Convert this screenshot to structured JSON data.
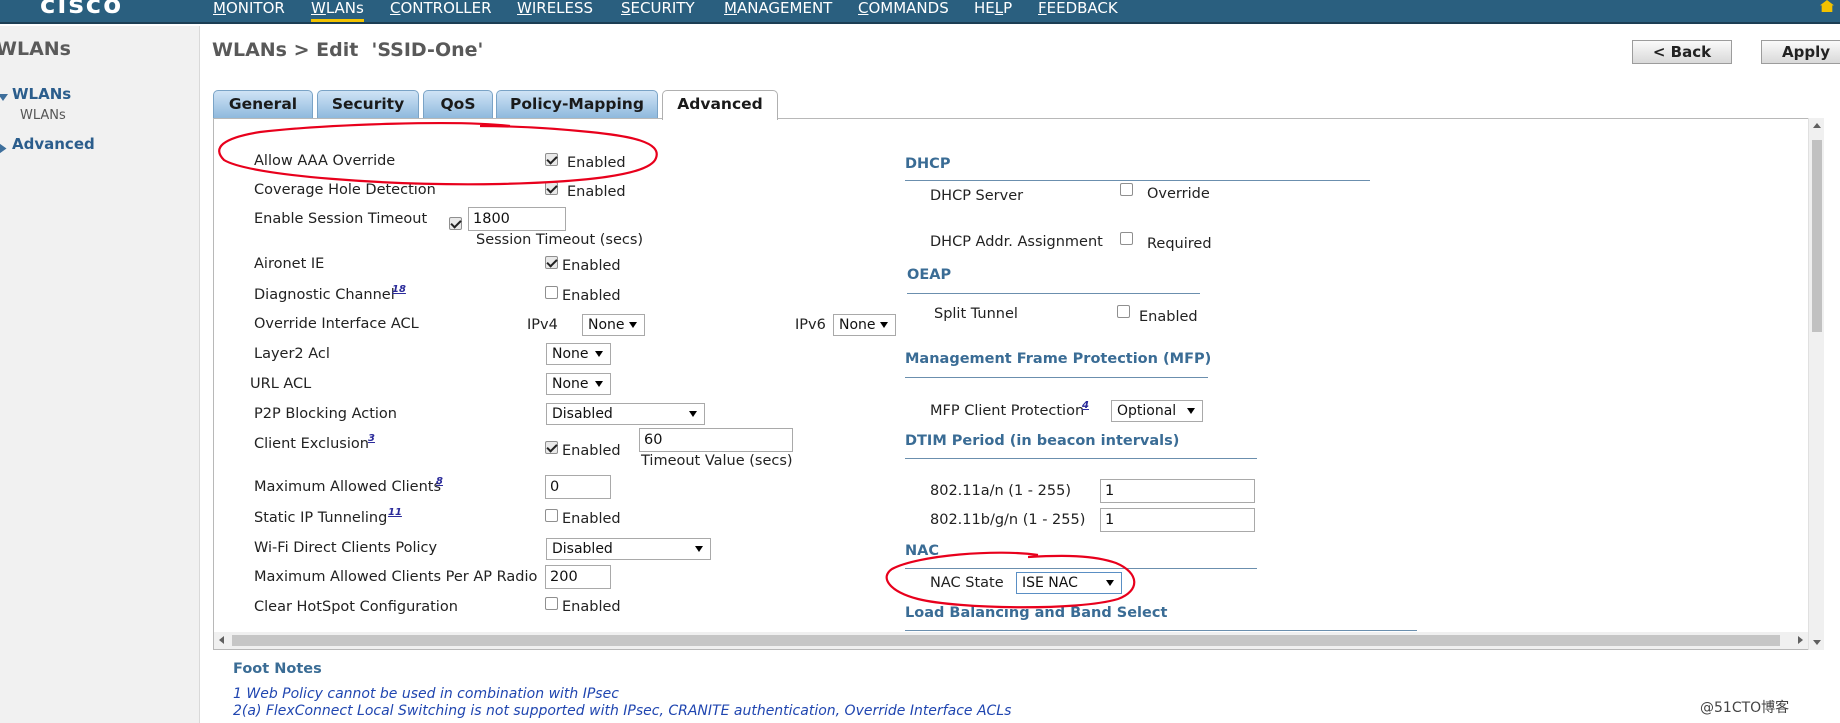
{
  "app": {
    "brand": "cisco"
  },
  "nav": {
    "items": [
      {
        "accel": "M",
        "rest": "ONITOR"
      },
      {
        "accel": "W",
        "rest": "LANs"
      },
      {
        "accel": "C",
        "rest": "ONTROLLER"
      },
      {
        "accel": "W",
        "rest": "IRELESS"
      },
      {
        "accel": "S",
        "rest": "ECURITY"
      },
      {
        "accel": "M",
        "rest": "ANAGEMENT"
      },
      {
        "accel": "C",
        "rest": "OMMANDS"
      },
      {
        "accel": "",
        "pre": "HE",
        "acc2": "L",
        "rest": "P"
      },
      {
        "accel": "F",
        "rest": "EEDBACK"
      }
    ],
    "active_index": 1
  },
  "sidebar": {
    "title": "WLANs",
    "groups": [
      {
        "label": "WLANs",
        "sub": "WLANs"
      },
      {
        "label": "Advanced"
      }
    ]
  },
  "header": {
    "title": "WLANs > Edit  'SSID-One'",
    "back_label": "< Back",
    "apply_label": "Apply"
  },
  "tabs": [
    "General",
    "Security",
    "QoS",
    "Policy-Mapping",
    "Advanced"
  ],
  "active_tab": "Advanced",
  "left": {
    "allow_aaa_override": {
      "label": "Allow AAA Override",
      "checked": true,
      "text": "Enabled"
    },
    "coverage_hole": {
      "label": "Coverage Hole Detection",
      "checked": true,
      "text": "Enabled"
    },
    "session_timeout": {
      "label": "Enable Session Timeout",
      "checked": true,
      "value": "1800",
      "sub": "Session Timeout (secs)"
    },
    "aironet_ie": {
      "label": "Aironet IE",
      "checked": true,
      "text": "Enabled"
    },
    "diagnostic_channel": {
      "label": "Diagnostic Channel",
      "footnote": "18",
      "checked": false,
      "text": "Enabled"
    },
    "override_acl": {
      "label": "Override Interface ACL",
      "ipv4_label": "IPv4",
      "ipv4_value": "None",
      "ipv6_label": "IPv6",
      "ipv6_value": "None"
    },
    "layer2_acl": {
      "label": "Layer2 Acl",
      "value": "None"
    },
    "url_acl": {
      "label": "URL ACL",
      "value": "None"
    },
    "p2p_blocking": {
      "label": "P2P Blocking Action",
      "value": "Disabled"
    },
    "client_exclusion": {
      "label": "Client Exclusion",
      "footnote": "3",
      "checked": true,
      "text": "Enabled",
      "value": "60",
      "sub": "Timeout Value (secs)"
    },
    "max_clients": {
      "label": "Maximum Allowed Clients",
      "footnote": "8",
      "value": "0"
    },
    "static_ip": {
      "label": "Static IP Tunneling",
      "footnote": "11",
      "checked": false,
      "text": "Enabled"
    },
    "wifi_direct": {
      "label": "Wi-Fi Direct Clients Policy",
      "value": "Disabled"
    },
    "max_per_radio": {
      "label": "Maximum Allowed Clients Per AP Radio",
      "value": "200"
    },
    "clear_hotspot": {
      "label": "Clear HotSpot Configuration",
      "checked": false,
      "text": "Enabled"
    }
  },
  "right": {
    "dhcp": {
      "title": "DHCP",
      "server": {
        "label": "DHCP Server",
        "checked": false,
        "text": "Override"
      },
      "addr": {
        "label": "DHCP Addr. Assignment",
        "checked": false,
        "text": "Required"
      }
    },
    "oeap": {
      "title": "OEAP",
      "split": {
        "label": "Split Tunnel",
        "checked": false,
        "text": "Enabled"
      }
    },
    "mfp": {
      "title": "Management Frame Protection (MFP)",
      "client": {
        "label": "MFP Client Protection",
        "footnote": "4",
        "value": "Optional"
      }
    },
    "dtim": {
      "title": "DTIM Period (in beacon intervals)",
      "a": {
        "label": "802.11a/n (1 - 255)",
        "value": "1"
      },
      "bg": {
        "label": "802.11b/g/n (1 - 255)",
        "value": "1"
      }
    },
    "nac": {
      "title": "NAC",
      "state": {
        "label": "NAC State",
        "value": "ISE NAC"
      }
    },
    "lb": {
      "title": "Load Balancing and Band Select"
    }
  },
  "footnotes": {
    "title": "Foot Notes",
    "items": [
      "1 Web Policy cannot be used in combination with IPsec",
      "2(a) FlexConnect Local Switching is not supported with IPsec, CRANITE authentication, Override Interface ACLs"
    ]
  },
  "watermark": "@51CTO博客",
  "colors": {
    "nav_bg": "#2a5f7f",
    "accent": "#3a6c95",
    "annotation": "#e8001c"
  }
}
